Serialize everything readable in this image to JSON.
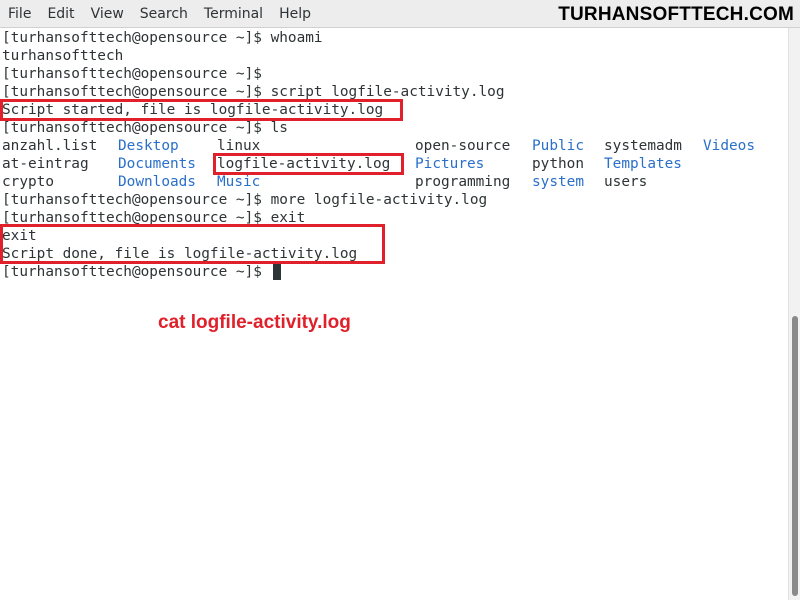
{
  "menubar": {
    "items": [
      "File",
      "Edit",
      "View",
      "Search",
      "Terminal",
      "Help"
    ],
    "watermark": "TURHANSOFTTECH.COM"
  },
  "terminal": {
    "lines": [
      "[turhansofttech@opensource ~]$ whoami",
      "turhansofttech",
      "[turhansofttech@opensource ~]$",
      "[turhansofttech@opensource ~]$ script logfile-activity.log",
      "Script started, file is logfile-activity.log",
      "[turhansofttech@opensource ~]$ ls"
    ],
    "ls_output": [
      [
        {
          "text": "anzahl.list",
          "dir": false
        },
        {
          "text": "Desktop",
          "dir": true
        },
        {
          "text": "linux",
          "dir": false
        },
        {
          "text": "open-source",
          "dir": false
        },
        {
          "text": "Public",
          "dir": true
        },
        {
          "text": "systemadm",
          "dir": false
        },
        {
          "text": "Videos",
          "dir": true
        }
      ],
      [
        {
          "text": "at-eintrag",
          "dir": false
        },
        {
          "text": "Documents",
          "dir": true
        },
        {
          "text": "logfile-activity.log",
          "dir": false
        },
        {
          "text": "Pictures",
          "dir": true
        },
        {
          "text": "python",
          "dir": false
        },
        {
          "text": "Templates",
          "dir": true
        }
      ],
      [
        {
          "text": "crypto",
          "dir": false
        },
        {
          "text": "Downloads",
          "dir": true
        },
        {
          "text": "Music",
          "dir": true
        },
        {
          "text": "programming",
          "dir": false
        },
        {
          "text": "system",
          "dir": true
        },
        {
          "text": "users",
          "dir": false
        }
      ]
    ],
    "after_lines": [
      "[turhansofttech@opensource ~]$ more logfile-activity.log",
      "[turhansofttech@opensource ~]$ exit",
      "exit",
      "Script done, file is logfile-activity.log"
    ],
    "prompt": "[turhansofttech@opensource ~]$ "
  },
  "annotation": {
    "text": "cat logfile-activity.log"
  },
  "colors": {
    "text": "#2e3436",
    "directory": "#2a6fc9",
    "highlight": "#e0202a"
  }
}
